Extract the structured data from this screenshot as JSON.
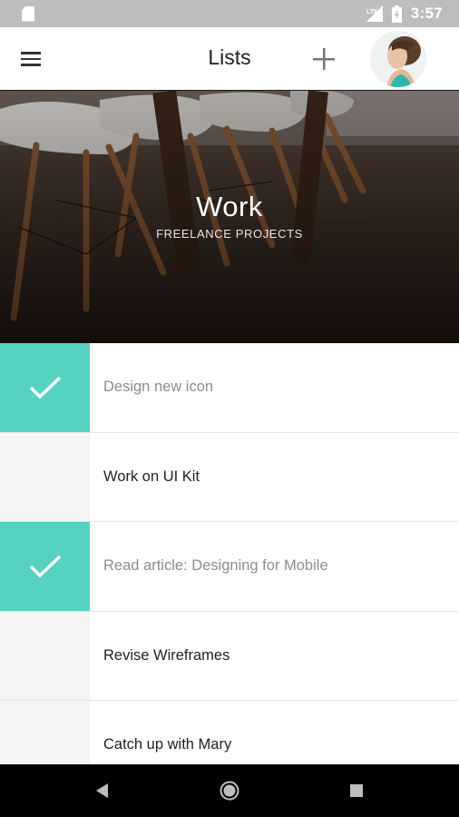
{
  "status_bar": {
    "time": "3:57",
    "icons": [
      "sd-card-icon",
      "signal-icon",
      "battery-icon"
    ]
  },
  "app_bar": {
    "title": "Lists",
    "icons": [
      "menu-icon",
      "plus-icon",
      "avatar"
    ]
  },
  "hero": {
    "title": "Work",
    "subtitle": "FREELANCE PROJECTS"
  },
  "tasks": [
    {
      "label": "Design new icon",
      "done": true
    },
    {
      "label": "Work on UI Kit",
      "done": false
    },
    {
      "label": "Read article: Designing for Mobile",
      "done": true
    },
    {
      "label": "Revise Wireframes",
      "done": false
    },
    {
      "label": "Catch up with Mary",
      "done": false
    }
  ],
  "nav_bar": {
    "icons": [
      "back-icon",
      "home-icon",
      "recents-icon"
    ]
  },
  "colors": {
    "accent": "#56d2c1",
    "status_bar": "#bdbdbd",
    "nav_bar": "#000000"
  }
}
